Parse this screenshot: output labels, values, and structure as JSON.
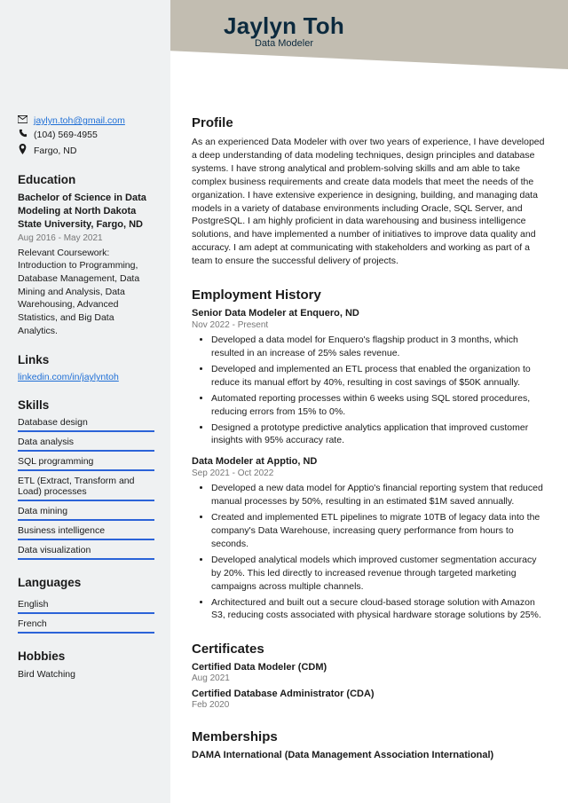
{
  "header": {
    "name": "Jaylyn Toh",
    "title": "Data Modeler"
  },
  "contacts": {
    "email": "jaylyn.toh@gmail.com",
    "phone": "(104) 569-4955",
    "location": "Fargo, ND"
  },
  "sidebar": {
    "education_heading": "Education",
    "education": {
      "degree": "Bachelor of Science in Data Modeling at North Dakota State University, Fargo, ND",
      "dates": "Aug 2016 - May 2021",
      "body": "Relevant Coursework: Introduction to Programming, Database Management, Data Mining and Analysis, Data Warehousing, Advanced Statistics, and Big Data Analytics."
    },
    "links_heading": "Links",
    "links": [
      "linkedin.com/in/jaylyntoh"
    ],
    "skills_heading": "Skills",
    "skills": [
      "Database design",
      "Data analysis",
      "SQL programming",
      "ETL (Extract, Transform and Load) processes",
      "Data mining",
      "Business intelligence",
      "Data visualization"
    ],
    "languages_heading": "Languages",
    "languages": [
      "English",
      "French"
    ],
    "hobbies_heading": "Hobbies",
    "hobbies": "Bird Watching"
  },
  "main": {
    "profile_heading": "Profile",
    "profile": "As an experienced Data Modeler with over two years of experience, I have developed a deep understanding of data modeling techniques, design principles and database systems. I have strong analytical and problem-solving skills and am able to take complex business requirements and create data models that meet the needs of the organization. I have extensive experience in designing, building, and managing data models in a variety of database environments including Oracle, SQL Server, and PostgreSQL. I am highly proficient in data warehousing and business intelligence solutions, and have implemented a number of initiatives to improve data quality and accuracy. I am adept at communicating with stakeholders and working as part of a team to ensure the successful delivery of projects.",
    "employment_heading": "Employment History",
    "jobs": [
      {
        "title": "Senior Data Modeler at Enquero, ND",
        "dates": "Nov 2022 - Present",
        "bullets": [
          "Developed a data model for Enquero's flagship product in 3 months, which resulted in an increase of 25% sales revenue.",
          "Developed and implemented an ETL process that enabled the organization to reduce its manual effort by 40%, resulting in cost savings of $50K annually.",
          "Automated reporting processes within 6 weeks using SQL stored procedures, reducing errors from 15% to 0%.",
          "Designed a prototype predictive analytics application that improved customer insights with 95% accuracy rate."
        ]
      },
      {
        "title": "Data Modeler at Apptio, ND",
        "dates": "Sep 2021 - Oct 2022",
        "bullets": [
          "Developed a new data model for Apptio's financial reporting system that reduced manual processes by 50%, resulting in an estimated $1M saved annually.",
          "Created and implemented ETL pipelines to migrate 10TB of legacy data into the company's Data Warehouse, increasing query performance from hours to seconds.",
          "Developed analytical models which improved customer segmentation accuracy by 20%. This led directly to increased revenue through targeted marketing campaigns across multiple channels.",
          "Architectured and built out a secure cloud-based storage solution with Amazon S3, reducing costs associated with physical hardware storage solutions by 25%."
        ]
      }
    ],
    "certificates_heading": "Certificates",
    "certificates": [
      {
        "title": "Certified Data Modeler (CDM)",
        "date": "Aug 2021"
      },
      {
        "title": "Certified Database Administrator (CDA)",
        "date": "Feb 2020"
      }
    ],
    "memberships_heading": "Memberships",
    "memberships": [
      "DAMA International (Data Management Association International)"
    ]
  }
}
